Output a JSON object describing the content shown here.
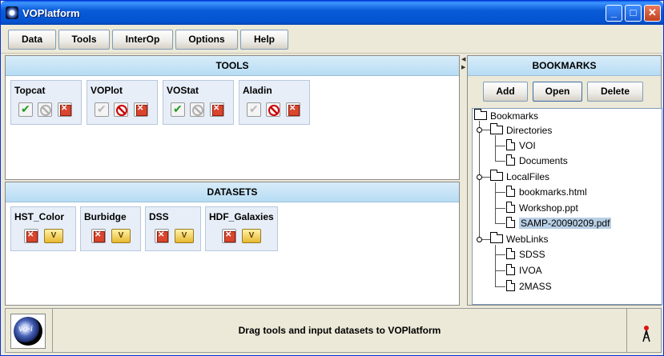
{
  "window": {
    "title": "VOPlatform",
    "minimize": "_",
    "maximize": "□",
    "close": "✕"
  },
  "menu": [
    "Data",
    "Tools",
    "InterOp",
    "Options",
    "Help"
  ],
  "tools": {
    "header": "TOOLS",
    "items": [
      {
        "name": "Topcat",
        "buttons": [
          "check-enabled",
          "prohibit-disabled",
          "remove"
        ]
      },
      {
        "name": "VOPlot",
        "buttons": [
          "check-disabled",
          "prohibit-enabled",
          "remove"
        ]
      },
      {
        "name": "VOStat",
        "buttons": [
          "check-enabled",
          "prohibit-disabled",
          "remove"
        ]
      },
      {
        "name": "Aladin",
        "buttons": [
          "check-disabled",
          "prohibit-enabled",
          "remove"
        ]
      }
    ]
  },
  "datasets": {
    "header": "DATASETS",
    "items": [
      {
        "name": "HST_Color",
        "view_label": "V"
      },
      {
        "name": "Burbidge",
        "view_label": "V"
      },
      {
        "name": "DSS",
        "view_label": "V"
      },
      {
        "name": "HDF_Galaxies",
        "view_label": "V"
      }
    ]
  },
  "bookmarks": {
    "header": "BOOKMARKS",
    "buttons": {
      "add": "Add",
      "open": "Open",
      "delete": "Delete"
    },
    "tree": {
      "root": "Bookmarks",
      "folders": [
        {
          "name": "Directories",
          "files": [
            "VOI",
            "Documents"
          ]
        },
        {
          "name": "LocalFiles",
          "files": [
            "bookmarks.html",
            "Workshop.ppt",
            "SAMP-20090209.pdf"
          ]
        },
        {
          "name": "WebLinks",
          "files": [
            "SDSS",
            "IVOA",
            "2MASS"
          ]
        }
      ],
      "selected": "SAMP-20090209.pdf"
    }
  },
  "status": {
    "logo_text": "vo-i",
    "message": "Drag tools and input datasets to VOPlatform"
  },
  "colors": {
    "title_bar": "#0454d2",
    "panel_header": "#b7dcf4",
    "selection": "#b8cfe5",
    "remove_red": "#d9452d",
    "check_green": "#1f9a1f"
  }
}
